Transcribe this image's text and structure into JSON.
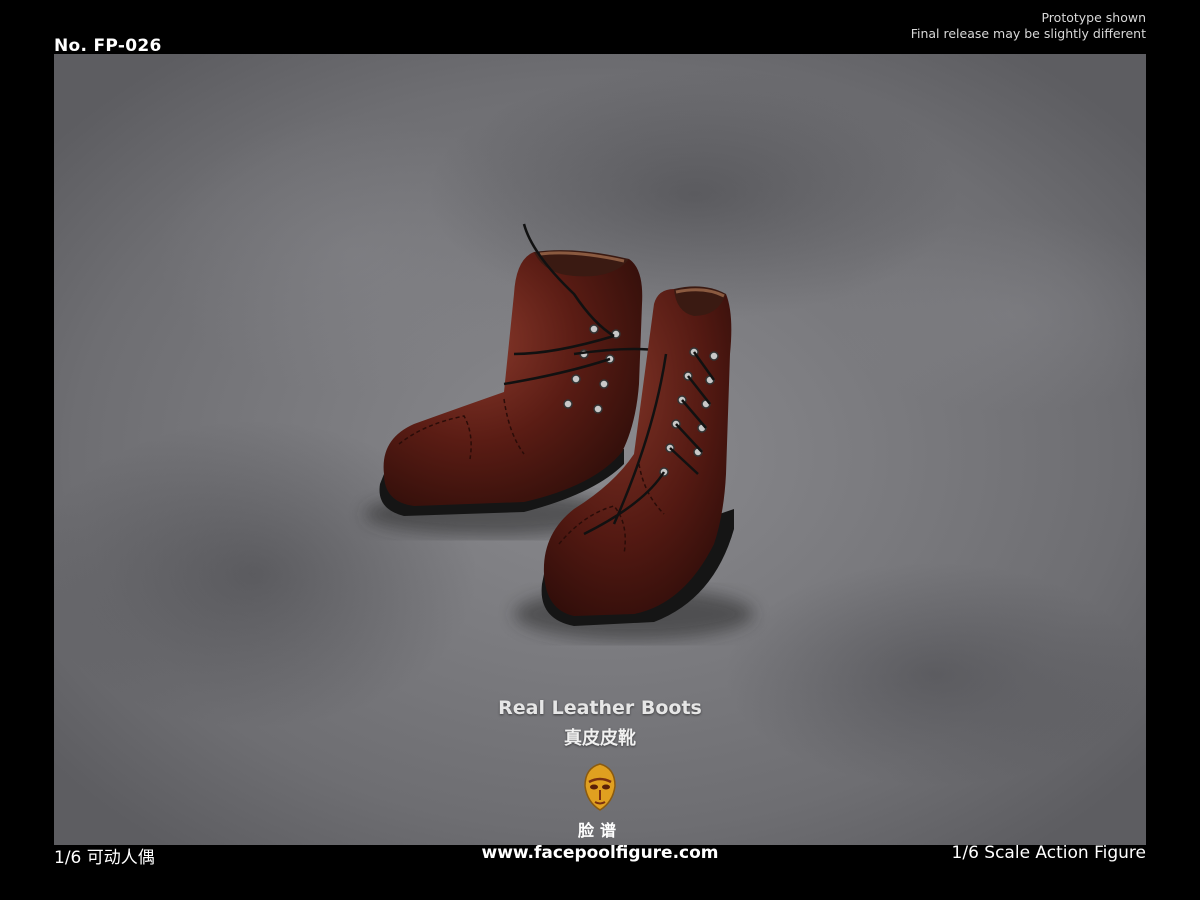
{
  "header": {
    "product_number": "No. FP-026",
    "disclaimer_line1": "Prototype shown",
    "disclaimer_line2": "Final release may be slightly different"
  },
  "caption": {
    "english": "Real Leather Boots",
    "chinese": "真皮皮靴"
  },
  "brand": {
    "logo_text": "脸谱",
    "url": "www.facepoolfigure.com"
  },
  "footer": {
    "left": "1/6 可动人偶",
    "right": "1/6 Scale Action Figure"
  },
  "colors": {
    "background": "#000000",
    "leather": "#5a1c14",
    "surface": "#7a7a7e"
  }
}
